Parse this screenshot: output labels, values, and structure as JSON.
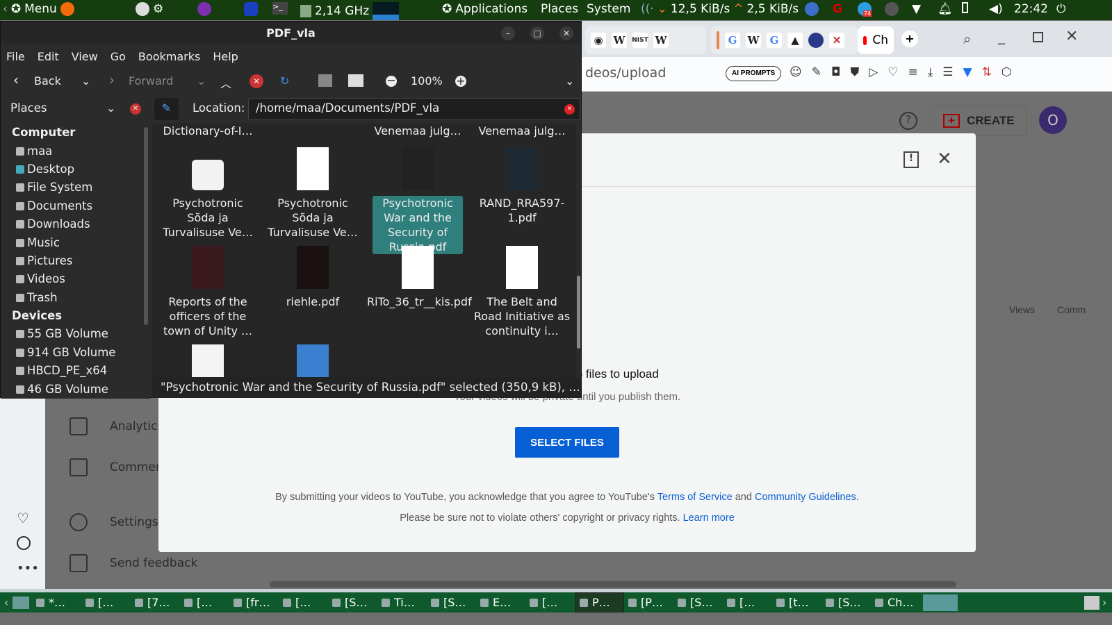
{
  "top_panel": {
    "menu": "Menu",
    "cpu": "2,14 GHz",
    "applications": "Applications",
    "places": "Places",
    "system": "System",
    "net_down": "12,5 KiB/s",
    "net_up": "2,5 KiB/s",
    "telegram_badge": "74",
    "clock": "22:42"
  },
  "browser": {
    "address_partial": "deos/upload",
    "ai_prompts": "AI PROMPTS",
    "active_tab": "Ch",
    "tab_icons": [
      "github",
      "W",
      "NIST",
      "W",
      "G",
      "W",
      "G"
    ]
  },
  "youtube": {
    "create": "CREATE",
    "avatar": "O",
    "nav": [
      "Analytics",
      "Comments",
      "Settings",
      "Send feedback"
    ],
    "col_views": "Views",
    "col_comments": "Comm",
    "dialog": {
      "drag_text": "Drag and drop video files to upload",
      "private_text": "Your videos will be private until you publish them.",
      "select_files": "SELECT FILES",
      "legal_1": "By submitting your videos to YouTube, you acknowledge that you agree to YouTube's",
      "terms": "Terms of Service",
      "and": "and",
      "guidelines": "Community Guidelines",
      "legal_2": "Please be sure not to violate others' copyright or privacy rights.",
      "learn_more": "Learn more"
    }
  },
  "file_manager": {
    "title": "PDF_vla",
    "menu": [
      "File",
      "Edit",
      "View",
      "Go",
      "Bookmarks",
      "Help"
    ],
    "toolbar": {
      "back": "Back",
      "forward": "Forward",
      "zoom": "100%"
    },
    "places_label": "Places",
    "location_label": "Location:",
    "location": "/home/maa/Documents/PDF_vla",
    "sidebar": {
      "computer": "Computer",
      "computer_items": [
        "maa",
        "Desktop",
        "File System",
        "Documents",
        "Downloads",
        "Music",
        "Pictures",
        "Videos",
        "Trash"
      ],
      "devices": "Devices",
      "device_items": [
        "55 GB Volume",
        "914 GB Volume",
        "HBCD_PE_x64",
        "46 GB Volume"
      ]
    },
    "files_top": [
      "Dictionary-of-I…",
      "",
      "Venemaa julg…",
      "Venemaa julg…"
    ],
    "files": [
      {
        "name": "Psychotronic Sõda ja Turvalisuse Ve…",
        "thumb": "#f2f2f2"
      },
      {
        "name": "Psychotronic Sõda ja Turvalisuse Ve…",
        "thumb": "#ffffff"
      },
      {
        "name": "Psychotronic War and the Security of Russia.pdf",
        "thumb": "#222222",
        "selected": true
      },
      {
        "name": "RAND_RRA597-1.pdf",
        "thumb": "#1d2a33"
      },
      {
        "name": "Reports of the officers of the town of Unity …",
        "thumb": "#3a1a1e"
      },
      {
        "name": "riehle.pdf",
        "thumb": "#1a1010"
      },
      {
        "name": "RiTo_36_tr__kis.pdf",
        "thumb": "#ffffff"
      },
      {
        "name": "The Belt and Road Initiative as continuity i…",
        "thumb": "#ffffff"
      }
    ],
    "status": "\"Psychotronic War and the Security of Russia.pdf\" selected (350,9 kB), Fr…"
  },
  "taskbar": {
    "items": [
      "*…",
      "[…",
      "[7…",
      "[…",
      "[fr…",
      "[…",
      "[S…",
      "Ti…",
      "[S…",
      "E…",
      "[…",
      "P…",
      "[P…",
      "[S…",
      "[…",
      "[t…",
      "[S…",
      "Ch…"
    ],
    "active_index": 11
  }
}
